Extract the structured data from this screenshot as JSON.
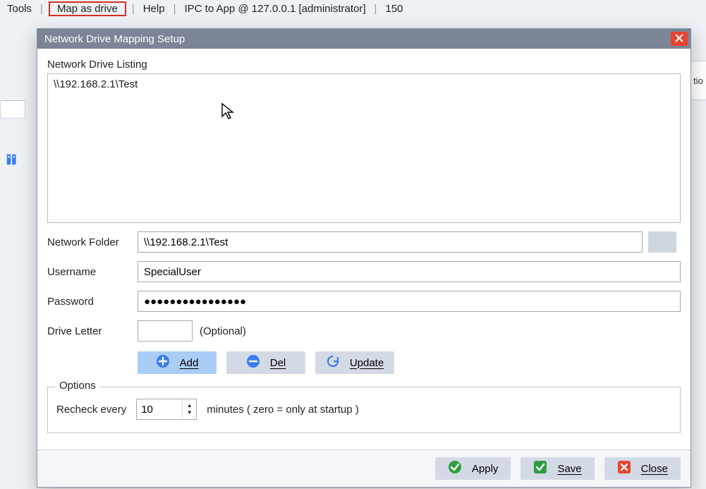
{
  "menubar": {
    "tools": "Tools",
    "map_as_drive": "Map as drive",
    "help": "Help",
    "ipc": "IPC to App @ 127.0.0.1 [administrator]",
    "count": "150"
  },
  "bg": {
    "right_tab_text": "tio"
  },
  "dialog": {
    "title": "Network Drive Mapping Setup",
    "listing_label": "Network Drive Listing",
    "listing_items": [
      "\\\\192.168.2.1\\Test"
    ],
    "form": {
      "network_folder_label": "Network Folder",
      "network_folder_value": "\\\\192.168.2.1\\Test",
      "username_label": "Username",
      "username_value": "SpecialUser",
      "password_label": "Password",
      "password_value": "●●●●●●●●●●●●●●●●",
      "drive_letter_label": "Drive Letter",
      "drive_letter_value": "",
      "optional_text": "(Optional)"
    },
    "buttons": {
      "add": "Add",
      "del": "Del",
      "update": "Update"
    },
    "options": {
      "legend": "Options",
      "recheck_label": "Recheck every",
      "recheck_value": "10",
      "minutes_text": "minutes ( zero = only at startup )"
    },
    "footer": {
      "apply": "Apply",
      "save": "Save",
      "close": "Close"
    }
  }
}
